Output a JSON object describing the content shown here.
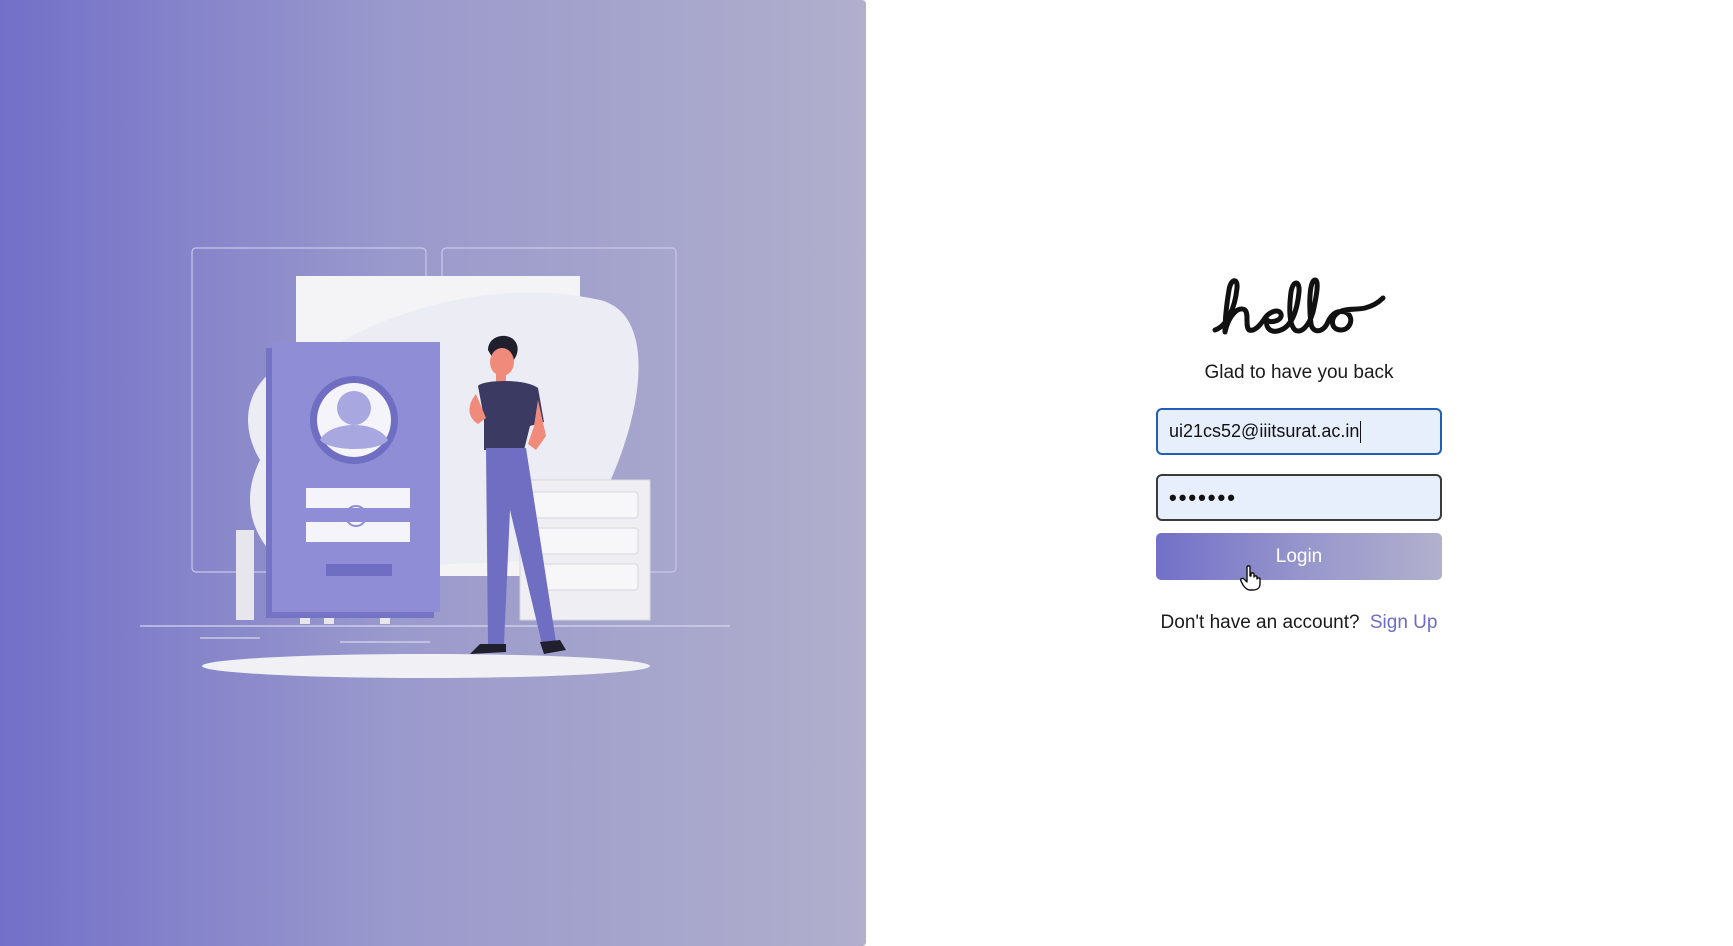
{
  "login": {
    "logo_text": "hello",
    "subtitle": "Glad to have you back",
    "email_value": "ui21cs52@iiitsurat.ac.in",
    "password_mask": "•••••••",
    "login_label": "Login",
    "signup_prompt": "Don't have an account?",
    "signup_link": "Sign Up"
  },
  "colors": {
    "accent": "#7270c8",
    "accent_light": "#b0afcc",
    "input_bg": "#e7effd",
    "focus_border": "#1f5fb8",
    "link": "#6e6cc4"
  },
  "icons": {
    "cursor": "hand-pointer-icon",
    "illustration": "login-illustration"
  }
}
